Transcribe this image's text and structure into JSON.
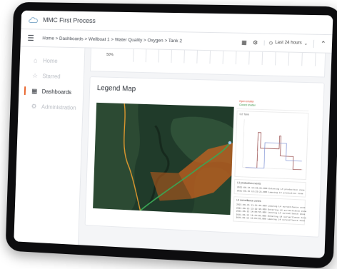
{
  "app": {
    "title": "MMC First Process"
  },
  "breadcrumb": "Home > Dashboards > Wellboat 1 > Water Quality > Oxygen > Tank 2",
  "time_range": "Last 24 hours",
  "sidebar": {
    "items": [
      {
        "label": "Home",
        "icon": "home-icon"
      },
      {
        "label": "Starred",
        "icon": "star-icon"
      },
      {
        "label": "Dashboards",
        "icon": "dashboards-icon",
        "active": true
      },
      {
        "label": "Administration",
        "icon": "gear-icon"
      }
    ]
  },
  "top_panel": {
    "value": "50%"
  },
  "legend_map": {
    "title": "Legend Map",
    "status": {
      "open": "Open shutter",
      "closed": "Closed shutter"
    },
    "chart_label": "O2 Tank",
    "logs": [
      {
        "title": "L3 production events",
        "lines": [
          "2021-06-15 12:02:01.000 Entering L3 production zone",
          "2021-06-15 12:25:21.000 Leaving L3 production zone"
        ]
      },
      {
        "title": "L4 surveillance zones",
        "lines": [
          "2021-06-15 11:51:29.000 Leaving L4 surveillance zone",
          "2021-06-15 13:12:19.000 Entering L4 surveillance zone",
          "2021-06-15 14:03:55.000 Leaving L4 surveillance zone",
          "2021-06-15 14:41:05.000 Entering L4 surveillance zone",
          "2021-06-15 15:01:02.000 Leaving L4 surveillance zone"
        ]
      }
    ]
  },
  "colors": {
    "accent": "#e8632a",
    "logo": "#7fa9c9",
    "route_green": "#3aa655",
    "route_orange": "#e39a2e",
    "zone": "#c8621f"
  }
}
